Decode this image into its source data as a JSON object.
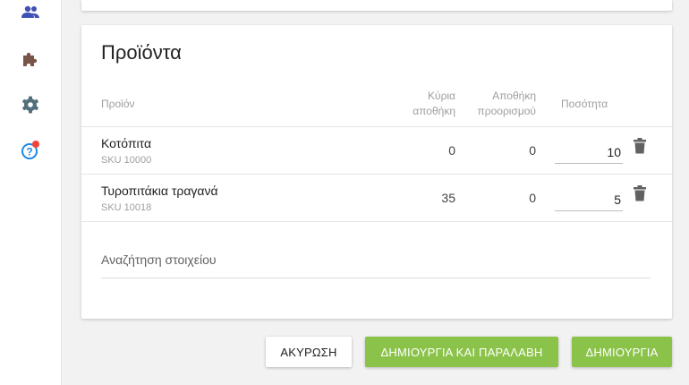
{
  "sidebar": {
    "icons": [
      "people-icon",
      "puzzle-icon",
      "gear-icon",
      "help-icon"
    ],
    "badge_color": "#f44336"
  },
  "products": {
    "title": "Προϊόντα",
    "headers": {
      "product": "Προϊόν",
      "main_warehouse": [
        "Κύρια",
        "αποθήκη"
      ],
      "destination_warehouse": [
        "Αποθήκη",
        "προορισμού"
      ],
      "quantity": "Ποσότητα"
    },
    "rows": [
      {
        "name": "Κοτόπιτα",
        "sku": "SKU 10000",
        "main": "0",
        "dest": "0",
        "qty": "10"
      },
      {
        "name": "Τυροπιτάκια τραγανά",
        "sku": "SKU 10018",
        "main": "35",
        "dest": "0",
        "qty": "5"
      }
    ],
    "search_placeholder": "Αναζήτηση στοιχείου"
  },
  "actions": {
    "cancel": "ΑΚΥΡΩΣΗ",
    "create_and_receive": "ΔΗΜΙΟΥΡΓΙΑ ΚΑΙ ΠΑΡΑΛΑΒΗ",
    "create": "ΔΗΜΙΟΥΡΓΙΑ"
  },
  "colors": {
    "accent": "#8bc34a",
    "sidebar_icon": "#3f51b5"
  }
}
